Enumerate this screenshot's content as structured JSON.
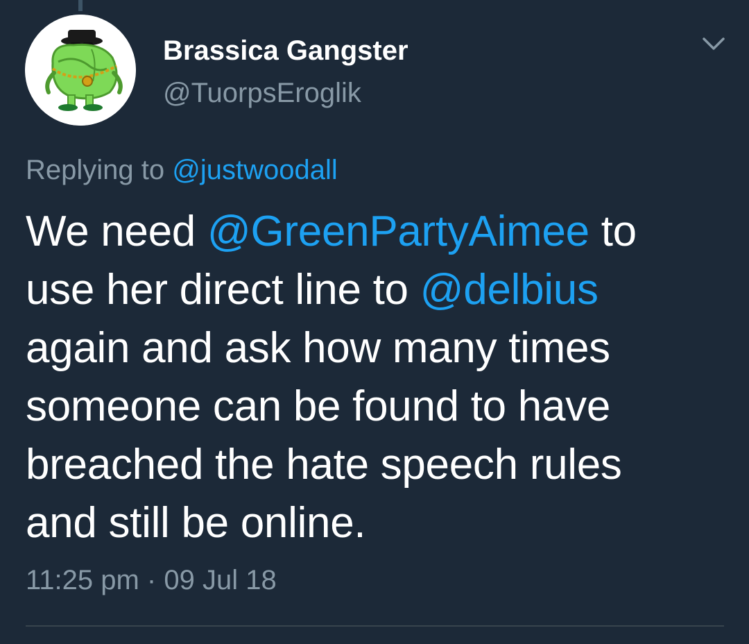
{
  "tweet": {
    "author": {
      "display_name": "Brassica Gangster",
      "handle": "@TuorpsEroglik",
      "avatar_icon": "brassica-gangster-avatar"
    },
    "reply": {
      "prefix": "Replying to",
      "mention": "@justwoodall"
    },
    "text": {
      "line1_a": "We need ",
      "line1_mention": "@GreenPartyAimee",
      "line1_b": " to",
      "line2_a": "use her direct line to ",
      "line2_mention": "@delbius",
      "line3": "again and ask how many times",
      "line4": "someone can be found to have",
      "line5": "breached the hate speech rules",
      "line6": "and still be online."
    },
    "timestamp": {
      "time": "11:25 pm",
      "separator": " · ",
      "date": "09 Jul 18"
    },
    "menu_icon": "chevron-down-icon"
  },
  "colors": {
    "background": "#1c2938",
    "text": "#ffffff",
    "secondary_text": "#8899a6",
    "link": "#1da1f2",
    "divider": "#38444d"
  }
}
